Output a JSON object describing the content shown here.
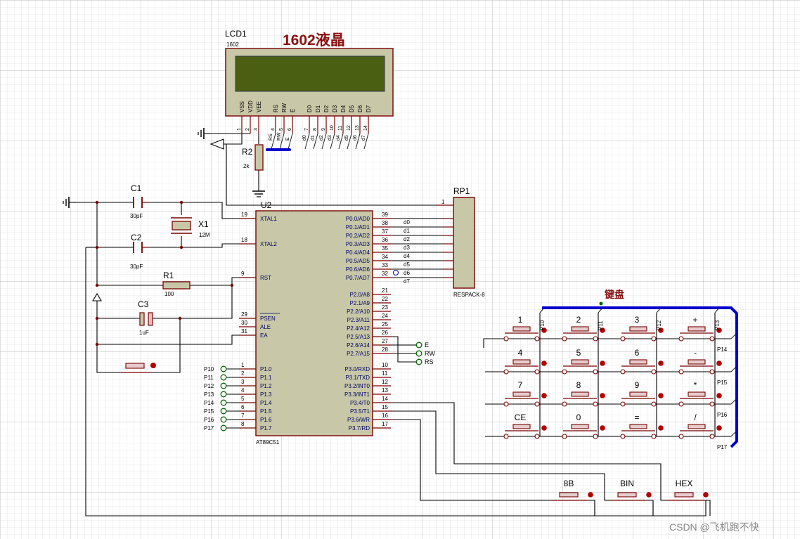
{
  "colors": {
    "wire": "#000000",
    "part": "#7a0000",
    "body": "#c8c8a8",
    "lcd_screen": "#4b5f13",
    "bus": "#0000cc",
    "pin_label": "#000066",
    "grid": "#d7d7d7",
    "grid_major": "#b9b9b9"
  },
  "lcd": {
    "ref": "LCD1",
    "model": "1602",
    "title": "1602液晶",
    "pins": [
      "VSS",
      "VDD",
      "VEE",
      "RS",
      "RW",
      "E",
      "D0",
      "D1",
      "D2",
      "D3",
      "D4",
      "D5",
      "D6",
      "D7"
    ],
    "pin_numbers": [
      "1",
      "2",
      "3",
      "4",
      "5",
      "6",
      "7",
      "8",
      "9",
      "10",
      "11",
      "12",
      "13",
      "14"
    ],
    "net_labels": [
      "RS",
      "RW",
      "E",
      "d0",
      "d1",
      "d2",
      "d3",
      "d4",
      "d5",
      "d6",
      "d7"
    ]
  },
  "r2": {
    "ref": "R2",
    "value": "2k"
  },
  "u2": {
    "ref": "U2",
    "model": "AT89C51",
    "left_pins": [
      {
        "num": "19",
        "name": "XTAL1"
      },
      {
        "num": "18",
        "name": "XTAL2"
      },
      {
        "num": "9",
        "name": "RST"
      },
      {
        "num": "29",
        "name": "PSEN"
      },
      {
        "num": "30",
        "name": "ALE"
      },
      {
        "num": "31",
        "name": "EA"
      },
      {
        "num": "1",
        "name": "P1.0"
      },
      {
        "num": "2",
        "name": "P1.1"
      },
      {
        "num": "3",
        "name": "P1.2"
      },
      {
        "num": "4",
        "name": "P1.3"
      },
      {
        "num": "5",
        "name": "P1.4"
      },
      {
        "num": "6",
        "name": "P1.5"
      },
      {
        "num": "7",
        "name": "P1.6"
      },
      {
        "num": "8",
        "name": "P1.7"
      }
    ],
    "right_pins": [
      {
        "num": "39",
        "name": "P0.0/AD0"
      },
      {
        "num": "38",
        "name": "P0.1/AD1"
      },
      {
        "num": "37",
        "name": "P0.2/AD2"
      },
      {
        "num": "36",
        "name": "P0.3/AD3"
      },
      {
        "num": "35",
        "name": "P0.4/AD4"
      },
      {
        "num": "34",
        "name": "P0.5/AD5"
      },
      {
        "num": "33",
        "name": "P0.6/AD6"
      },
      {
        "num": "32",
        "name": "P0.7/AD7"
      },
      {
        "num": "21",
        "name": "P2.0/A8"
      },
      {
        "num": "22",
        "name": "P2.1/A9"
      },
      {
        "num": "23",
        "name": "P2.2/A10"
      },
      {
        "num": "24",
        "name": "P2.3/A11"
      },
      {
        "num": "25",
        "name": "P2.4/A12"
      },
      {
        "num": "26",
        "name": "P2.5/A13"
      },
      {
        "num": "27",
        "name": "P2.6/A14"
      },
      {
        "num": "28",
        "name": "P2.7/A15"
      },
      {
        "num": "10",
        "name": "P3.0/RXD"
      },
      {
        "num": "11",
        "name": "P3.1/TXD"
      },
      {
        "num": "12",
        "name": "P3.2/INT0"
      },
      {
        "num": "13",
        "name": "P3.3/INT1"
      },
      {
        "num": "14",
        "name": "P3.4/T0"
      },
      {
        "num": "15",
        "name": "P3.5/T1"
      },
      {
        "num": "16",
        "name": "P3.6/WR"
      },
      {
        "num": "17",
        "name": "P3.7/RD"
      }
    ]
  },
  "p0_nets": [
    "d0",
    "d1",
    "d2",
    "d3",
    "d4",
    "d5",
    "d6",
    "d7"
  ],
  "p2_nets": [
    "E",
    "RW",
    "RS"
  ],
  "p1_terminals": [
    "P10",
    "P11",
    "P12",
    "P13",
    "P14",
    "P15",
    "P16",
    "P17"
  ],
  "rp1": {
    "ref": "RP1",
    "model": "RESPACK-8",
    "pin": "1"
  },
  "c1": {
    "ref": "C1",
    "value": "30pF"
  },
  "c2": {
    "ref": "C2",
    "value": "30pF"
  },
  "x1": {
    "ref": "X1",
    "value": "12M"
  },
  "r1": {
    "ref": "R1",
    "value": "100"
  },
  "c3": {
    "ref": "C3",
    "value": "1uF"
  },
  "keypad": {
    "title": "键盘",
    "keys": [
      "1",
      "2",
      "3",
      "+",
      "4",
      "5",
      "6",
      "-",
      "7",
      "8",
      "9",
      "*",
      "CE",
      "0",
      "=",
      "/"
    ],
    "column_labels": [
      "P10",
      "P11",
      "P12",
      "P13"
    ],
    "row_labels": [
      "P14",
      "P15",
      "P16",
      "P17"
    ]
  },
  "mode_buttons": [
    "8B",
    "BIN",
    "HEX"
  ],
  "watermark": "CSDN @飞机跑不快"
}
